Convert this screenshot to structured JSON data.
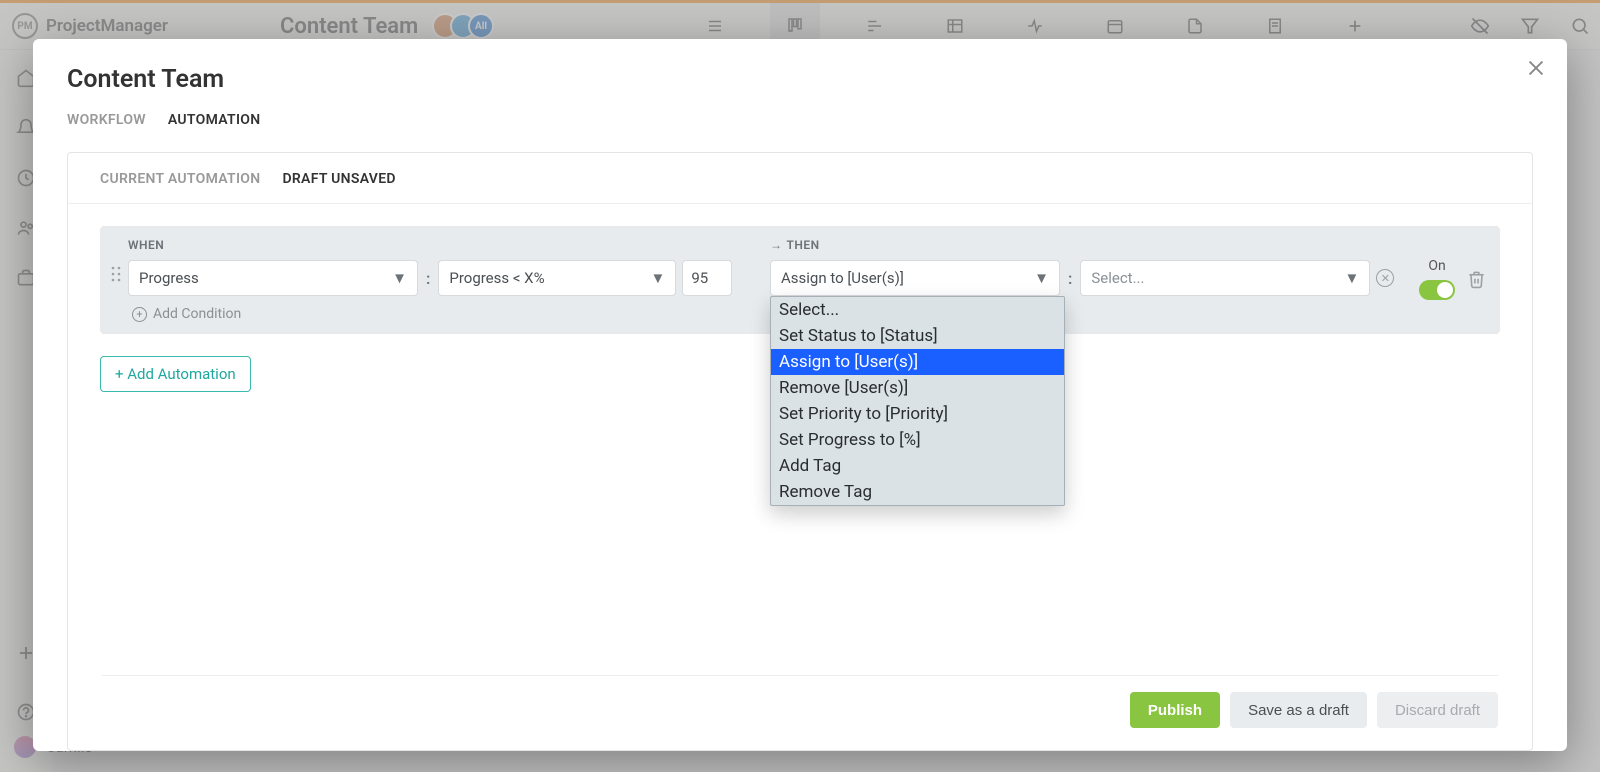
{
  "app": {
    "brand": "ProjectManager",
    "workspace_title": "Content Team",
    "current_user": "Camilo"
  },
  "modal": {
    "title": "Content Team",
    "tabs": [
      {
        "label": "WORKFLOW",
        "active": false
      },
      {
        "label": "AUTOMATION",
        "active": true
      }
    ],
    "panel_tabs": [
      {
        "label": "CURRENT AUTOMATION",
        "active": false
      },
      {
        "label": "DRAFT UNSAVED",
        "active": true
      }
    ],
    "rule": {
      "when_label": "WHEN",
      "then_label": "THEN",
      "trigger_field": "Progress",
      "condition_operator": "Progress < X%",
      "condition_value": "95",
      "add_condition_label": "Add Condition",
      "action_field": "Assign to [User(s)]",
      "action_target_placeholder": "Select...",
      "toggle_label": "On"
    },
    "add_automation_label": "+ Add Automation",
    "dropdown": {
      "options": [
        "Select...",
        "Set Status to [Status]",
        "Assign to [User(s)]",
        "Remove [User(s)]",
        "Set Priority to [Priority]",
        "Set Progress to [%]",
        "Add Tag",
        "Remove Tag"
      ],
      "selected_index": 2
    },
    "footer": {
      "publish": "Publish",
      "save_draft": "Save as a draft",
      "discard": "Discard draft"
    }
  }
}
